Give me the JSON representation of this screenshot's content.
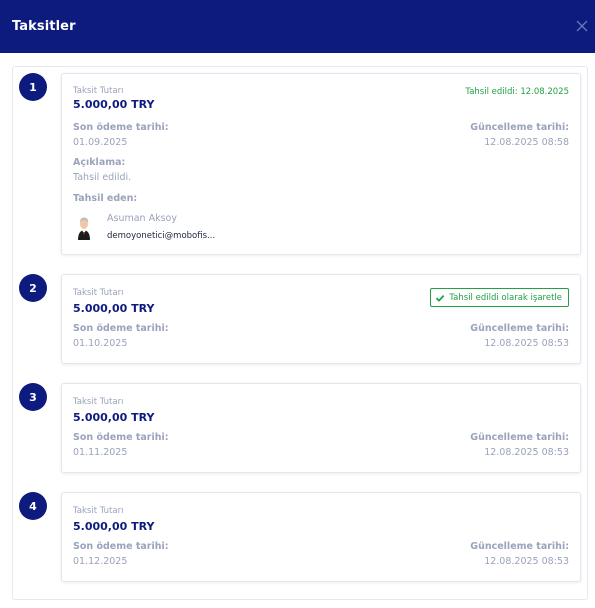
{
  "modal": {
    "title": "Taksitler"
  },
  "colors": {
    "header_bg": "#0e1b7e",
    "accent_green": "#22a046",
    "muted_label": "#9aa3bb"
  },
  "installments": [
    {
      "index": "1",
      "amount_label": "Taksit Tutarı",
      "amount": "5.000,00 TRY",
      "status_text": "Tahsil edildi: 12.08.2025",
      "due_label": "Son ödeme tarihi:",
      "due_date": "01.09.2025",
      "update_label": "Güncelleme tarihi:",
      "update_date": "12.08.2025 08:58",
      "description_label": "Açıklama:",
      "description": "Tahsil edildi.",
      "collector_label": "Tahsil eden:",
      "collector_name": "Asuman Aksoy",
      "collector_email": "demoyonetici@mobofis..."
    },
    {
      "index": "2",
      "amount_label": "Taksit Tutarı",
      "amount": "5.000,00 TRY",
      "action_label": "Tahsil edildi olarak işaretle",
      "due_label": "Son ödeme tarihi:",
      "due_date": "01.10.2025",
      "update_label": "Güncelleme tarihi:",
      "update_date": "12.08.2025 08:53"
    },
    {
      "index": "3",
      "amount_label": "Taksit Tutarı",
      "amount": "5.000,00 TRY",
      "due_label": "Son ödeme tarihi:",
      "due_date": "01.11.2025",
      "update_label": "Güncelleme tarihi:",
      "update_date": "12.08.2025 08:53"
    },
    {
      "index": "4",
      "amount_label": "Taksit Tutarı",
      "amount": "5.000,00 TRY",
      "due_label": "Son ödeme tarihi:",
      "due_date": "01.12.2025",
      "update_label": "Güncelleme tarihi:",
      "update_date": "12.08.2025 08:53"
    }
  ],
  "icons": {
    "close": "close-icon",
    "check": "check-icon"
  }
}
